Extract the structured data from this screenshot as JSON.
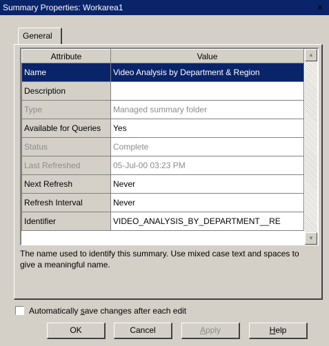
{
  "window": {
    "title": "Summary Properties: Workarea1",
    "close_label": "×"
  },
  "tabs": [
    {
      "label": "General",
      "active": true
    }
  ],
  "grid": {
    "columns": [
      "Attribute",
      "Value"
    ],
    "rows": [
      {
        "attribute": "Name",
        "value": "Video Analysis by Department & Region",
        "state": "selected"
      },
      {
        "attribute": "Description",
        "value": "",
        "state": "normal"
      },
      {
        "attribute": "Type",
        "value": "Managed summary folder",
        "state": "disabled"
      },
      {
        "attribute": "Available for Queries",
        "value": "Yes",
        "state": "normal"
      },
      {
        "attribute": "Status",
        "value": "Complete",
        "state": "disabled"
      },
      {
        "attribute": "Last Refreshed",
        "value": "05-Jul-00 03:23 PM",
        "state": "disabled"
      },
      {
        "attribute": "Next Refresh",
        "value": "Never",
        "state": "normal"
      },
      {
        "attribute": "Refresh Interval",
        "value": "Never",
        "state": "normal"
      },
      {
        "attribute": "Identifier",
        "value": "VIDEO_ANALYSIS_BY_DEPARTMENT__RE",
        "state": "normal"
      }
    ]
  },
  "description_text": "The name used to identify this summary. Use mixed case text and spaces to give a meaningful name.",
  "autosave": {
    "label_pre": "Automatically ",
    "label_mnemonic": "s",
    "label_post": "ave changes after each edit",
    "checked": false
  },
  "buttons": {
    "ok": "OK",
    "cancel": "Cancel",
    "apply_mnemonic": "A",
    "apply_rest": "pply",
    "help_mnemonic": "H",
    "help_rest": "elp"
  },
  "colors": {
    "face": "#d4d0c8",
    "selection": "#0a246a",
    "disabled_text": "#8c8c8c"
  }
}
